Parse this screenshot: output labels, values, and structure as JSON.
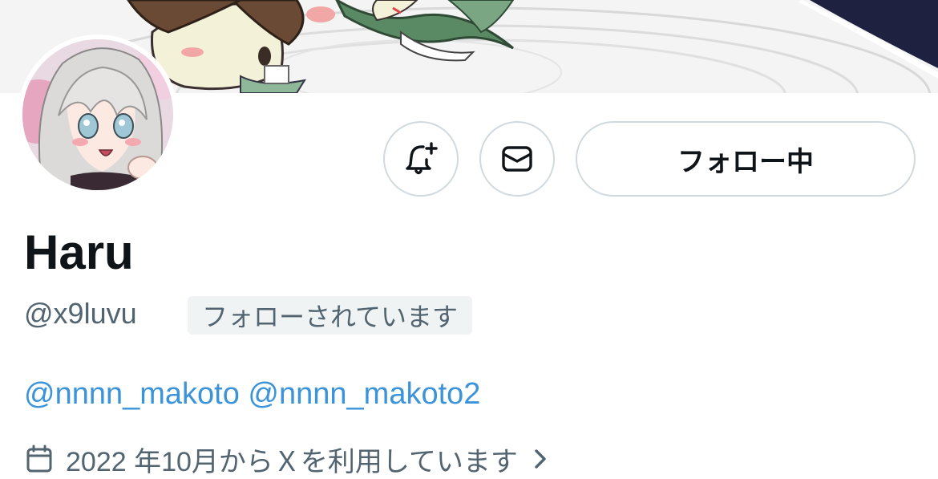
{
  "profile": {
    "display_name": "Haru",
    "handle": "@x9luvu",
    "follows_you_label": "フォローされています",
    "bio_mentions": [
      "@nnnn_makoto",
      "@nnnn_makoto2"
    ],
    "joined_label": "2022 年10月からＸを利用しています"
  },
  "actions": {
    "follow_label": "フォロー中"
  },
  "icons": {
    "notify": "bell-plus-icon",
    "message": "envelope-icon",
    "calendar": "calendar-icon",
    "chevron": "chevron-right-icon"
  },
  "colors": {
    "link": "#3b94d9",
    "secondary_text": "#536471",
    "border": "#cfd9de",
    "badge_bg": "#eff3f4"
  }
}
